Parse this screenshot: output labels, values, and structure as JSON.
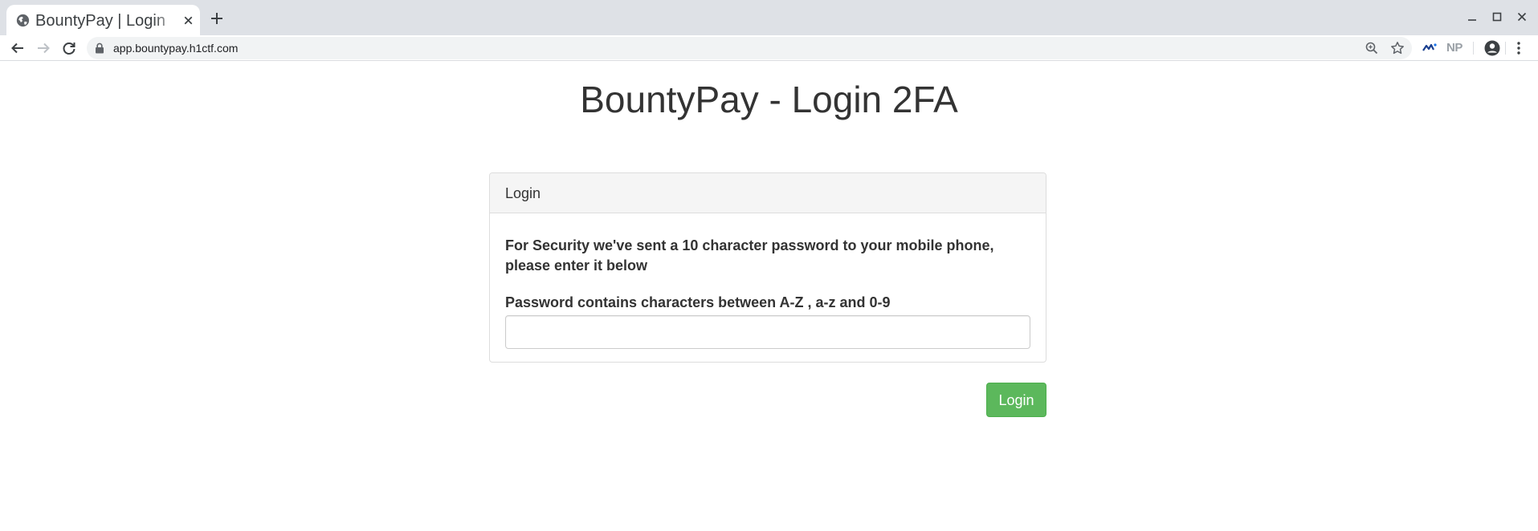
{
  "browser": {
    "tab": {
      "title": "BountyPay | Login",
      "favicon": "globe-icon",
      "close_icon": "close-icon"
    },
    "new_tab_icon": "plus-icon",
    "window_controls": [
      "minimize-icon",
      "maximize-icon",
      "close-icon"
    ],
    "address_bar": {
      "url": "app.bountypay.h1ctf.com",
      "secure_icon": "lock-icon"
    },
    "toolbar_icons": [
      "back-arrow-icon",
      "forward-arrow-icon",
      "reload-icon",
      "zoom-icon",
      "star-icon",
      "extension-icon",
      "profile-icon",
      "more-vertical-icon"
    ],
    "np_extension_label": "NP"
  },
  "page": {
    "title": "BountyPay - Login 2FA",
    "panel": {
      "heading": "Login",
      "message": "For Security we've sent a 10 character password to your mobile phone, please enter it below",
      "password_label": "Password contains characters between A-Z , a-z and 0-9",
      "password_value": "",
      "password_placeholder": ""
    },
    "login_button_label": "Login"
  },
  "colors": {
    "tabstrip_bg": "#dee1e6",
    "omnibox_bg": "#f1f3f4",
    "text": "#333333",
    "panel_border": "#dddddd",
    "panel_heading_bg": "#f5f5f5",
    "button_success": "#5cb85c"
  }
}
